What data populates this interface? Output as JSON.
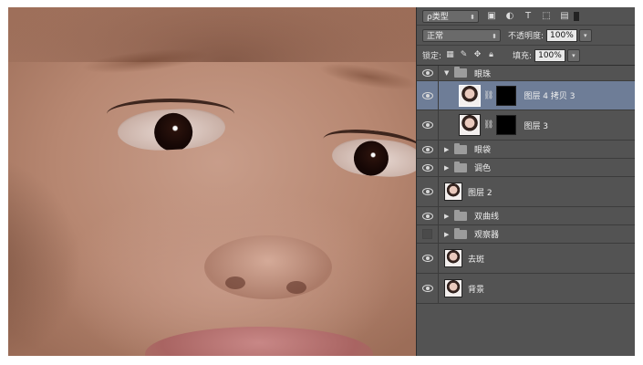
{
  "filter_bar": {
    "kind_label": "ρ类型",
    "icons": [
      "image-filter-icon",
      "adjustment-filter-icon",
      "type-filter-icon",
      "shape-filter-icon",
      "smart-object-filter-icon"
    ]
  },
  "blend_bar": {
    "mode": "正常",
    "opacity_label": "不透明度:",
    "opacity_value": "100%"
  },
  "lock_bar": {
    "lock_label": "锁定:",
    "fill_label": "填充:",
    "fill_value": "100%"
  },
  "layers": [
    {
      "name": "眼珠",
      "type": "group",
      "expanded": true,
      "visible": true
    },
    {
      "name": "图层 4 拷贝 3",
      "type": "layer",
      "mask": true,
      "selected": true,
      "visible": true
    },
    {
      "name": "图层 3",
      "type": "layer",
      "mask": true,
      "visible": true
    },
    {
      "name": "眼袋",
      "type": "group",
      "visible": true
    },
    {
      "name": "调色",
      "type": "group",
      "visible": true
    },
    {
      "name": "图层 2",
      "type": "layer",
      "visible": true
    },
    {
      "name": "双曲线",
      "type": "group",
      "visible": true
    },
    {
      "name": "观察器",
      "type": "group",
      "visible": false
    },
    {
      "name": "去斑",
      "type": "layer",
      "visible": true
    },
    {
      "name": "背景",
      "type": "layer",
      "visible": true
    }
  ],
  "colors": {
    "panel_bg": "#535353",
    "selected_row": "#6e7d97"
  }
}
